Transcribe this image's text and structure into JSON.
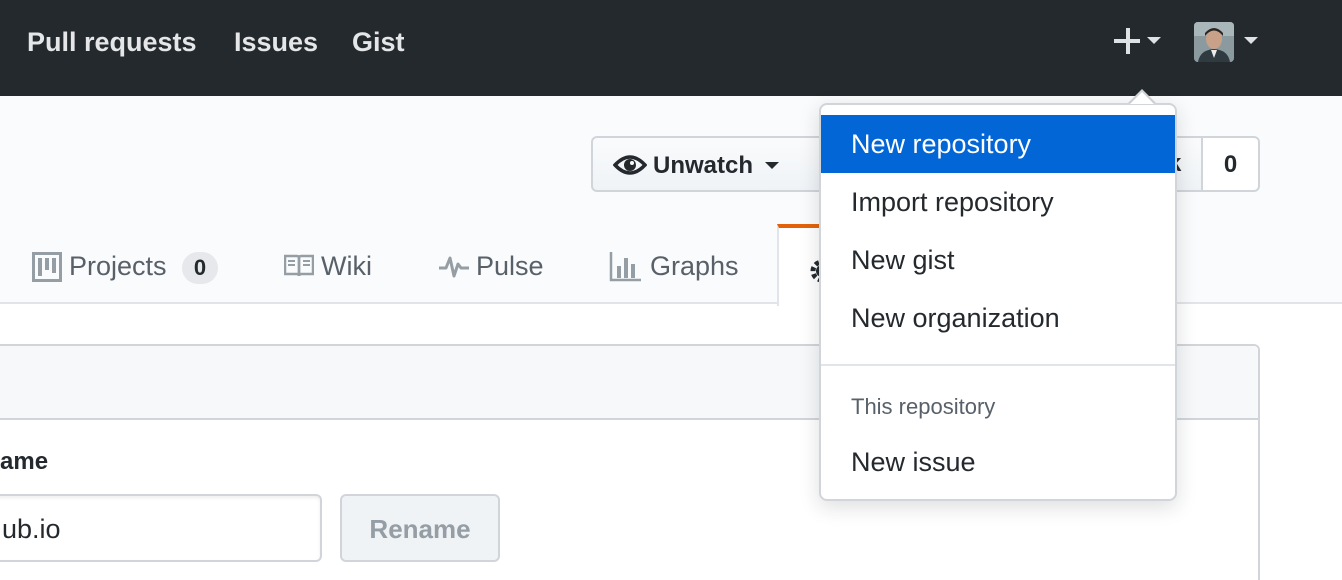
{
  "header": {
    "nav": [
      "Pull requests",
      "Issues",
      "Gist"
    ],
    "create_icon": "plus-icon",
    "avatar_alt": "user avatar"
  },
  "repo_actions": {
    "watch_label": "Unwatch",
    "watch_icon": "eye-icon",
    "partial_label": "k",
    "count": "0"
  },
  "tabs": [
    {
      "label": "Projects",
      "icon": "project-icon",
      "counter": "0"
    },
    {
      "label": "Wiki",
      "icon": "book-icon"
    },
    {
      "label": "Pulse",
      "icon": "pulse-icon"
    },
    {
      "label": "Graphs",
      "icon": "graph-icon"
    },
    {
      "label": "",
      "icon": "gear-icon",
      "selected": true
    }
  ],
  "settings": {
    "field_label": "ame",
    "input_value": "ub.io",
    "rename_label": "Rename"
  },
  "create_menu": {
    "items": [
      {
        "label": "New repository",
        "active": true
      },
      {
        "label": "Import repository"
      },
      {
        "label": "New gist"
      },
      {
        "label": "New organization"
      }
    ],
    "section_header": "This repository",
    "section_items": [
      {
        "label": "New issue"
      }
    ]
  },
  "colors": {
    "header_bg": "#24292e",
    "accent_blue": "#0366d6",
    "tab_selected_border": "#e36209"
  }
}
